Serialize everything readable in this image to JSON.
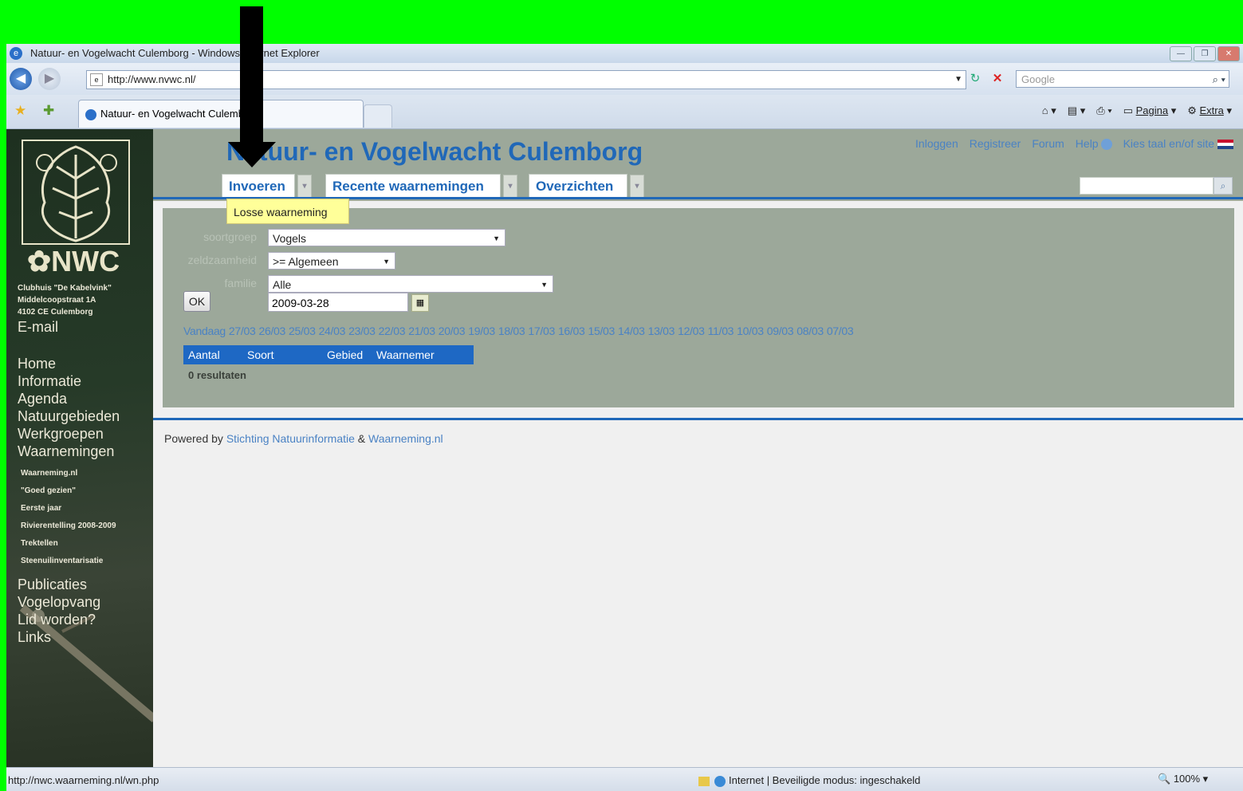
{
  "window": {
    "title": "Natuur- en Vogelwacht Culemborg - Windows Internet Explorer"
  },
  "browser": {
    "address": "http://www.nvwc.nl/",
    "search_placeholder": "Google",
    "tab_title": "Natuur- en Vogelwacht Culemborg",
    "commands": {
      "page": "Pagina",
      "extra": "Extra"
    }
  },
  "sidebar": {
    "address_lines": [
      "Clubhuis \"De Kabelvink\"",
      "Middelcoopstraat 1A",
      "4102 CE Culemborg"
    ],
    "email": "E-mail",
    "menu": [
      "Home",
      "Informatie",
      "Agenda",
      "Natuurgebieden",
      "Werkgroepen",
      "Waarnemingen"
    ],
    "submenu": [
      "Waarneming.nl",
      "\"Goed gezien\"",
      "Eerste jaar",
      "Rivierentelling 2008-2009",
      "Trektellen",
      "Steenuilinventarisatie"
    ],
    "menu2": [
      "Publicaties",
      "Vogelopvang",
      "Lid worden?",
      "Links"
    ]
  },
  "site": {
    "title": "Natuur- en Vogelwacht Culemborg",
    "top_links": [
      "Inloggen",
      "Registreer",
      "Forum",
      "Help",
      "Kies taal en/of site"
    ],
    "nav_tabs": [
      "Invoeren",
      "Recente waarnemingen",
      "Overzichten"
    ],
    "tooltip": "Losse waarneming"
  },
  "form": {
    "labels": {
      "soortgroep": "soortgroep",
      "zeldzaamheid": "zeldzaamheid",
      "familie": "familie"
    },
    "soortgroep": "Vogels",
    "zeldzaamheid": ">= Algemeen",
    "familie": "Alle",
    "ok_label": "OK",
    "date": "2009-03-28"
  },
  "date_links": [
    "Vandaag",
    "27/03",
    "26/03",
    "25/03",
    "24/03",
    "23/03",
    "22/03",
    "21/03",
    "20/03",
    "19/03",
    "18/03",
    "17/03",
    "16/03",
    "15/03",
    "14/03",
    "13/03",
    "12/03",
    "11/03",
    "10/03",
    "09/03",
    "08/03",
    "07/03"
  ],
  "table": {
    "columns": [
      "Aantal",
      "Soort",
      "Gebied",
      "Waarnemer"
    ],
    "results": "0 resultaten"
  },
  "footer": {
    "powered_by": "Powered by",
    "link1": "Stichting Natuurinformatie",
    "amp": "&",
    "link2": "Waarneming.nl"
  },
  "statusbar": {
    "url": "http://nwc.waarneming.nl/wn.php",
    "zone": "Internet | Beveiligde modus: ingeschakeld",
    "zoom": "100%"
  },
  "colors": {
    "highlight": "#00ff00",
    "accent": "#2068b8",
    "panel": "#9ca89a"
  }
}
